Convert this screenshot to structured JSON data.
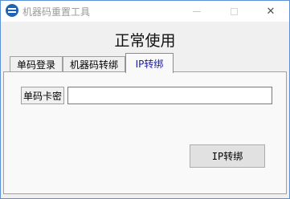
{
  "window": {
    "title": "机器码重置工具",
    "close_glyph": "✕"
  },
  "main": {
    "headline": "正常使用",
    "tabs": [
      {
        "label": "单码登录",
        "active": false
      },
      {
        "label": "机器码转绑",
        "active": false
      },
      {
        "label": "IP转绑",
        "active": true
      }
    ],
    "field": {
      "label": "单码卡密",
      "value": "",
      "placeholder": ""
    },
    "action_button_label": "IP转绑"
  },
  "colors": {
    "active_tab_text": "#1a1aa0",
    "window_border": "#5b8fd6",
    "app_icon": "#1e64b4"
  }
}
